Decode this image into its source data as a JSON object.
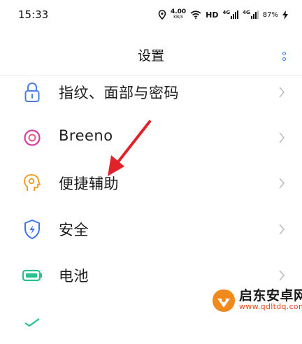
{
  "status_bar": {
    "time": "15:33",
    "net_speed_value": "4.00",
    "net_speed_unit": "KB/S",
    "hd_label": "HD",
    "sim1_label": "4G",
    "sim2_label": "4G",
    "battery": "87%"
  },
  "header": {
    "title": "设置",
    "more_icon": "more-vertical-icon",
    "accent_color": "#2f7cf6"
  },
  "settings": {
    "items": [
      {
        "label": "指纹、面部与密码",
        "icon": "lock-icon"
      },
      {
        "label": "Breeno",
        "icon": "breeno-icon"
      },
      {
        "label": "便捷辅助",
        "icon": "head-gear-icon"
      },
      {
        "label": "安全",
        "icon": "shield-icon"
      },
      {
        "label": "电池",
        "icon": "battery-icon"
      }
    ]
  },
  "annotation": {
    "arrow_color": "#e0232b"
  },
  "watermark": {
    "title": "启东安卓网",
    "url": "www.qdltdq.com"
  }
}
